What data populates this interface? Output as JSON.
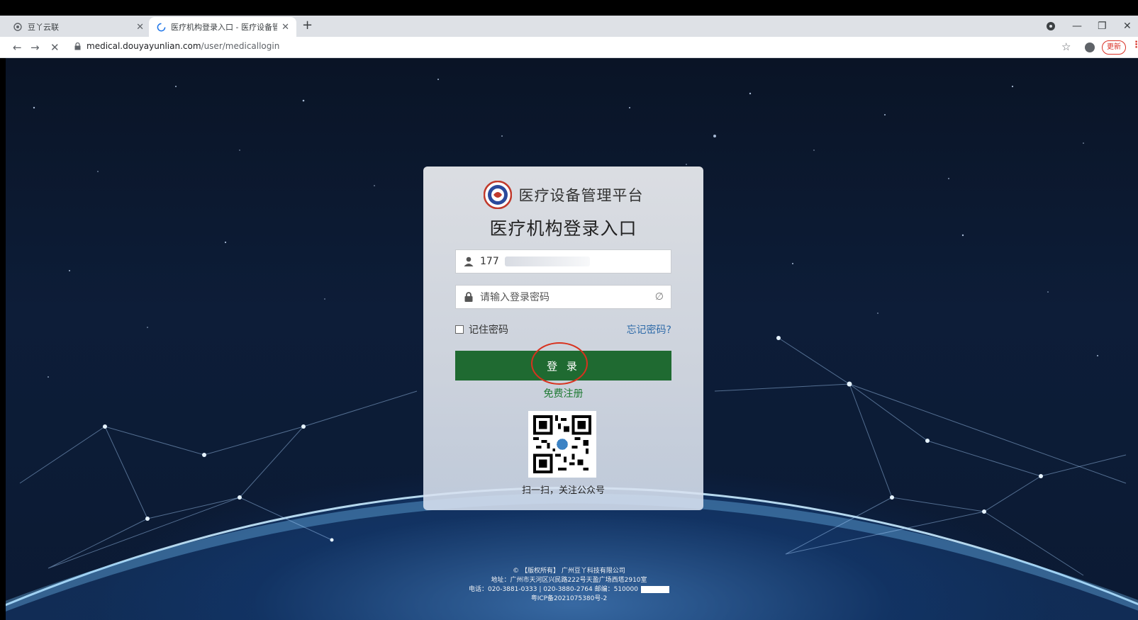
{
  "browser": {
    "tabs": [
      {
        "title": "豆丫云联",
        "active": false
      },
      {
        "title": "医疗机构登录入口 - 医疗设备管理",
        "active": true
      }
    ],
    "address": {
      "domain": "medical.douyayunlian.com",
      "path": "/user/medicallogin"
    },
    "update_label": "更新"
  },
  "login": {
    "platform_name": "医疗设备管理平台",
    "title": "医疗机构登录入口",
    "username_value": "177",
    "password_placeholder": "请输入登录密码",
    "remember_label": "记住密码",
    "forgot_label": "忘记密码?",
    "login_button": "登 录",
    "register_label": "免费注册",
    "qr_caption": "扫一扫，关注公众号"
  },
  "footer": {
    "line1": "© 【版权所有】 广州豆丫科技有限公司",
    "line2": "地址：广州市天河区兴民路222号天盈广场西塔2910室",
    "line3": "电话：020-3881-0333 | 020-3880-2764    邮编：510000",
    "line4": "粤ICP备2021075380号-2"
  },
  "colors": {
    "primary_green": "#1f6a31",
    "link_blue": "#2e6aa8",
    "annotation_red": "#d8321e"
  }
}
